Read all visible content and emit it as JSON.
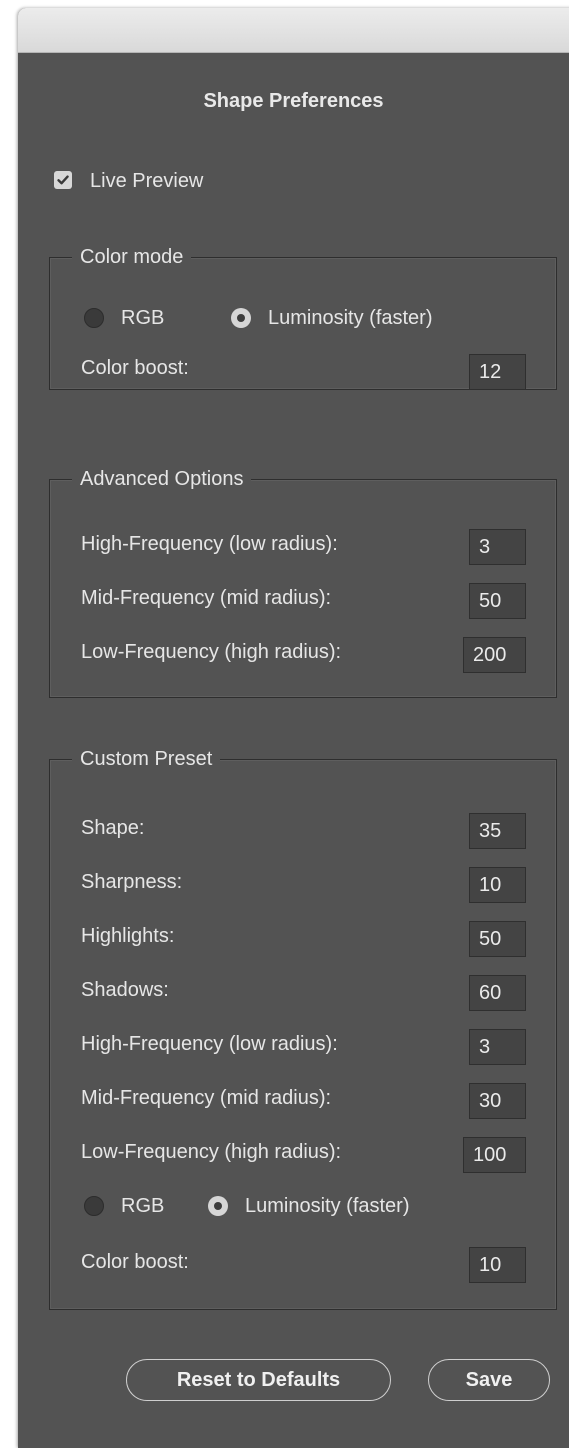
{
  "title": "Shape Preferences",
  "live_preview": {
    "label": "Live Preview",
    "checked": true
  },
  "color_mode": {
    "legend": "Color mode",
    "rgb_label": "RGB",
    "luminosity_label": "Luminosity (faster)",
    "selected": "luminosity",
    "color_boost_label": "Color boost:",
    "color_boost_value": "12"
  },
  "advanced_options": {
    "legend": "Advanced Options",
    "rows": [
      {
        "label": "High-Frequency (low radius):",
        "value": "3"
      },
      {
        "label": "Mid-Frequency (mid radius):",
        "value": "50"
      },
      {
        "label": "Low-Frequency (high radius):",
        "value": "200"
      }
    ]
  },
  "custom_preset": {
    "legend": "Custom Preset",
    "rows": [
      {
        "label": "Shape:",
        "value": "35"
      },
      {
        "label": "Sharpness:",
        "value": "10"
      },
      {
        "label": "Highlights:",
        "value": "50"
      },
      {
        "label": "Shadows:",
        "value": "60"
      },
      {
        "label": "High-Frequency (low radius):",
        "value": "3"
      },
      {
        "label": "Mid-Frequency (mid radius):",
        "value": "30"
      },
      {
        "label": "Low-Frequency (high radius):",
        "value": "100"
      }
    ],
    "rgb_label": "RGB",
    "luminosity_label": "Luminosity (faster)",
    "selected": "luminosity",
    "color_boost_label": "Color boost:",
    "color_boost_value": "10"
  },
  "buttons": {
    "reset_label": "Reset to Defaults",
    "save_label": "Save"
  },
  "colors": {
    "panel": "#535353",
    "text": "#e6e6e6",
    "field": "#444444"
  }
}
